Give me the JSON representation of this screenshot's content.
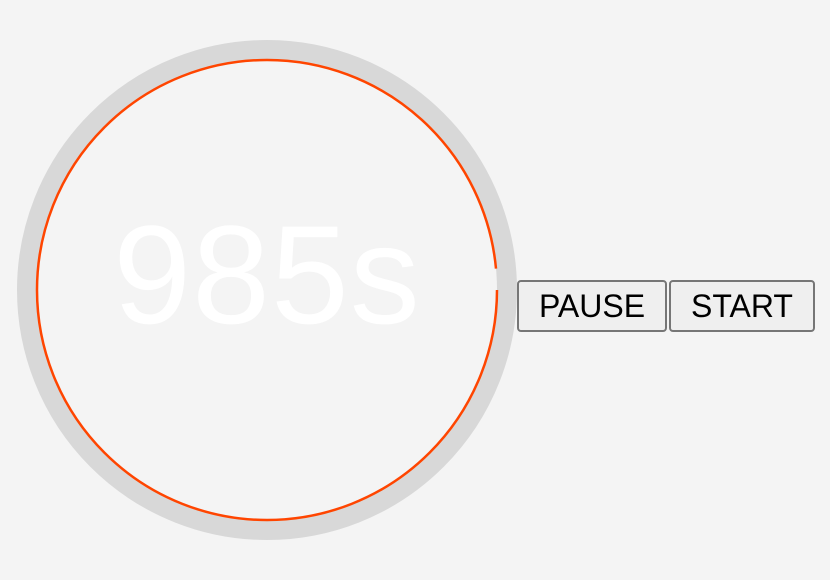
{
  "timer": {
    "display": "985s",
    "progress_fraction": 0.985,
    "track_color": "#d8d8d8",
    "progress_color": "#ff4500",
    "text_color": "#ffffff"
  },
  "controls": {
    "pause_label": "PAUSE",
    "start_label": "START"
  },
  "page": {
    "background": "#f4f4f4"
  }
}
